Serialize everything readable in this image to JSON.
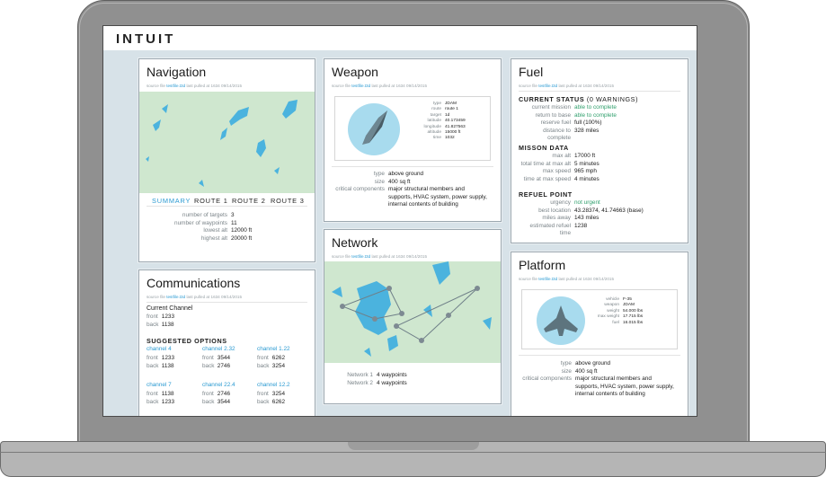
{
  "brand": "INTUIT",
  "source": {
    "prefix": "source file",
    "file": "testfile.t3d",
    "suffix": "last pulled at 1634 09/14/2015"
  },
  "navigation": {
    "title": "Navigation",
    "tabs": [
      "SUMMARY",
      "ROUTE 1",
      "ROUTE 2",
      "ROUTE 3"
    ],
    "active_tab": "SUMMARY",
    "stats": [
      {
        "label": "number of targets",
        "value": "3"
      },
      {
        "label": "number of waypoints",
        "value": "11"
      },
      {
        "label": "lowest alt",
        "value": "12000 ft"
      },
      {
        "label": "highest alt",
        "value": "20000 ft"
      }
    ]
  },
  "communications": {
    "title": "Communications",
    "current_label": "Current Channel",
    "current": [
      {
        "label": "front",
        "value": "1233"
      },
      {
        "label": "back",
        "value": "1138"
      }
    ],
    "suggested_label": "SUGGESTED OPTIONS",
    "options": [
      {
        "name": "channel 4",
        "front": "1233",
        "back": "1138"
      },
      {
        "name": "channel 2.32",
        "front": "3544",
        "back": "2746"
      },
      {
        "name": "channel 1.22",
        "front": "6262",
        "back": "3254"
      },
      {
        "name": "channel 7",
        "front": "1138",
        "back": "1233"
      },
      {
        "name": "channel 22.4",
        "front": "2746",
        "back": "3544"
      },
      {
        "name": "channel 12.2",
        "front": "3254",
        "back": "6262"
      }
    ],
    "front_label": "front",
    "back_label": "back"
  },
  "weapon": {
    "title": "Weapon",
    "spec": [
      {
        "label": "type",
        "value": "JDAM"
      },
      {
        "label": "route",
        "value": "route 1"
      },
      {
        "label": "target",
        "value": "1d"
      },
      {
        "label": "latitude",
        "value": "40.173459"
      },
      {
        "label": "longitude",
        "value": "41.827563"
      },
      {
        "label": "altitude",
        "value": "15000 ft"
      },
      {
        "label": "time",
        "value": "1032"
      }
    ],
    "info": [
      {
        "label": "type",
        "value": "above ground"
      },
      {
        "label": "size",
        "value": "400 sq ft"
      },
      {
        "label": "critical components",
        "value": "major structural members and supports, HVAC system, power supply, internal contents of building"
      }
    ]
  },
  "network": {
    "title": "Network",
    "rows": [
      {
        "label": "Network 1",
        "value": "4 waypoints"
      },
      {
        "label": "Network 2",
        "value": "4 waypoints"
      }
    ]
  },
  "fuel": {
    "title": "Fuel",
    "status_label": "CURRENT STATUS",
    "warnings": "(0 WARNINGS)",
    "status": [
      {
        "label": "current mission",
        "value": "able to complete",
        "ok": true
      },
      {
        "label": "return to base",
        "value": "able to complete",
        "ok": true
      },
      {
        "label": "reserve fuel",
        "value": "full (100%)"
      },
      {
        "label": "distance to complete",
        "value": "328 miles"
      }
    ],
    "mission_label": "MISSON DATA",
    "mission": [
      {
        "label": "max alt",
        "value": "17000 ft"
      },
      {
        "label": "total time at max alt",
        "value": "5 minutes"
      },
      {
        "label": "max speed",
        "value": "965 mph"
      },
      {
        "label": "time at max speed",
        "value": "4 minutes"
      }
    ],
    "refuel_label": "REFUEL POINT",
    "refuel": [
      {
        "label": "urgency",
        "value": "not urgent",
        "ok": true
      },
      {
        "label": "best location",
        "value": "43.28374, 41.74663 (base)"
      },
      {
        "label": "miles away",
        "value": "143 miles"
      },
      {
        "label": "estimated refuel time",
        "value": "1238"
      }
    ]
  },
  "platform": {
    "title": "Platform",
    "spec": [
      {
        "label": "vehicle",
        "value": "F-35"
      },
      {
        "label": "weapon",
        "value": "JDAM"
      },
      {
        "label": "weight",
        "value": "54.000 lbs"
      },
      {
        "label": "max weight",
        "value": "17.715 lbs"
      },
      {
        "label": "fuel",
        "value": "16.015 lbs"
      }
    ],
    "info": [
      {
        "label": "type",
        "value": "above ground"
      },
      {
        "label": "size",
        "value": "400 sq ft"
      },
      {
        "label": "critical components",
        "value": "major structural members and supports, HVAC system, power supply, internal contents of building"
      }
    ]
  },
  "colors": {
    "accent": "#2a9ad2",
    "ok": "#2f9f6c",
    "map_land": "#cfe7cf",
    "map_water": "#4bb3de",
    "screen_bg": "#d7e2e8"
  }
}
